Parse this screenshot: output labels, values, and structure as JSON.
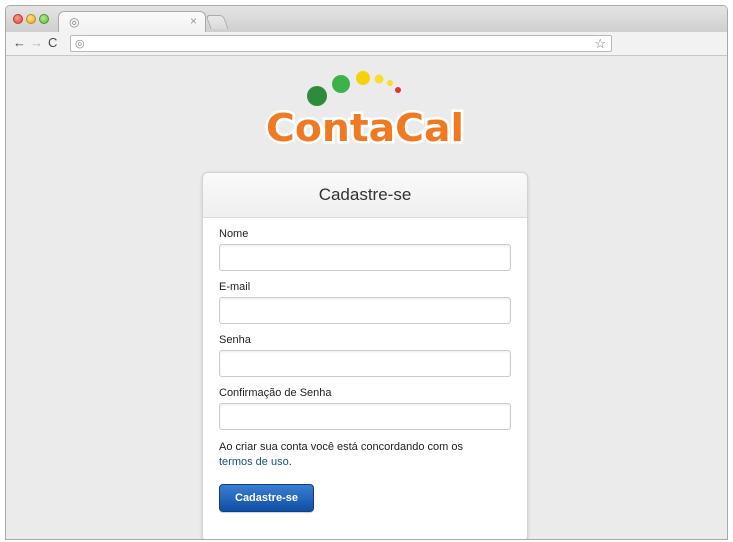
{
  "browser": {
    "tab_icon": "globe-icon",
    "tab_close": "×",
    "back": "←",
    "forward": "→",
    "reload": "C",
    "omnibox_icon": "globe-icon",
    "bookmark_star": "☆"
  },
  "logo": {
    "text": "ContaCal",
    "colors": {
      "text": "#f07a22",
      "dot_dark_green": "#2e8b3a",
      "dot_green": "#3db24a",
      "dot_yellow": "#f3d40a",
      "dot_red": "#e8302a"
    }
  },
  "form": {
    "title": "Cadastre-se",
    "fields": [
      {
        "label": "Nome",
        "value": ""
      },
      {
        "label": "E-mail",
        "value": ""
      },
      {
        "label": "Senha",
        "value": ""
      },
      {
        "label": "Confirmação de Senha",
        "value": ""
      }
    ],
    "terms_text": "Ao criar sua conta você está concordando com os",
    "terms_link": "termos de uso",
    "terms_end": ".",
    "submit_label": "Cadastre-se",
    "accent": "#1558b0"
  }
}
